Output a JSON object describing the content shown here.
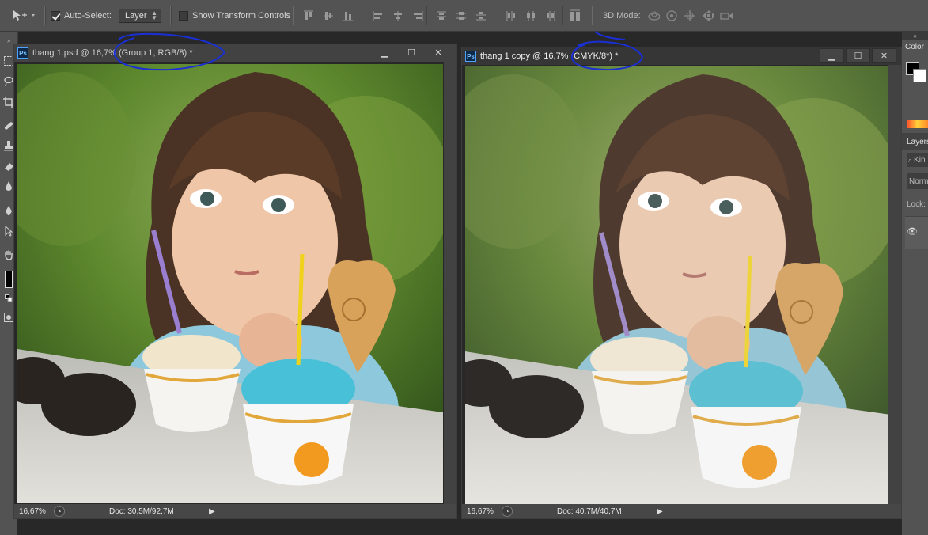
{
  "options_bar": {
    "auto_select_label": "Auto-Select:",
    "auto_select_checked": true,
    "auto_select_target": "Layer",
    "show_transform_label": "Show Transform Controls",
    "mode_3d_label": "3D Mode:"
  },
  "documents": [
    {
      "title": "thang 1.psd @ 16,7% (Group 1, RGB/8) *",
      "zoom": "16,67%",
      "doc_size": "Doc: 30,5M/92,7M",
      "active": false
    },
    {
      "title": "thang 1 copy @ 16,7% (CMYK/8*) *",
      "zoom": "16,67%",
      "doc_size": "Doc: 40,7M/40,7M",
      "active": true
    }
  ],
  "right_panel": {
    "color_tab": "Color",
    "layers_tab": "Layers",
    "kind_label": "Kin",
    "blend_mode": "Norm",
    "lock_label": "Lock:"
  },
  "annotation": {
    "color": "#1a2fd6"
  }
}
